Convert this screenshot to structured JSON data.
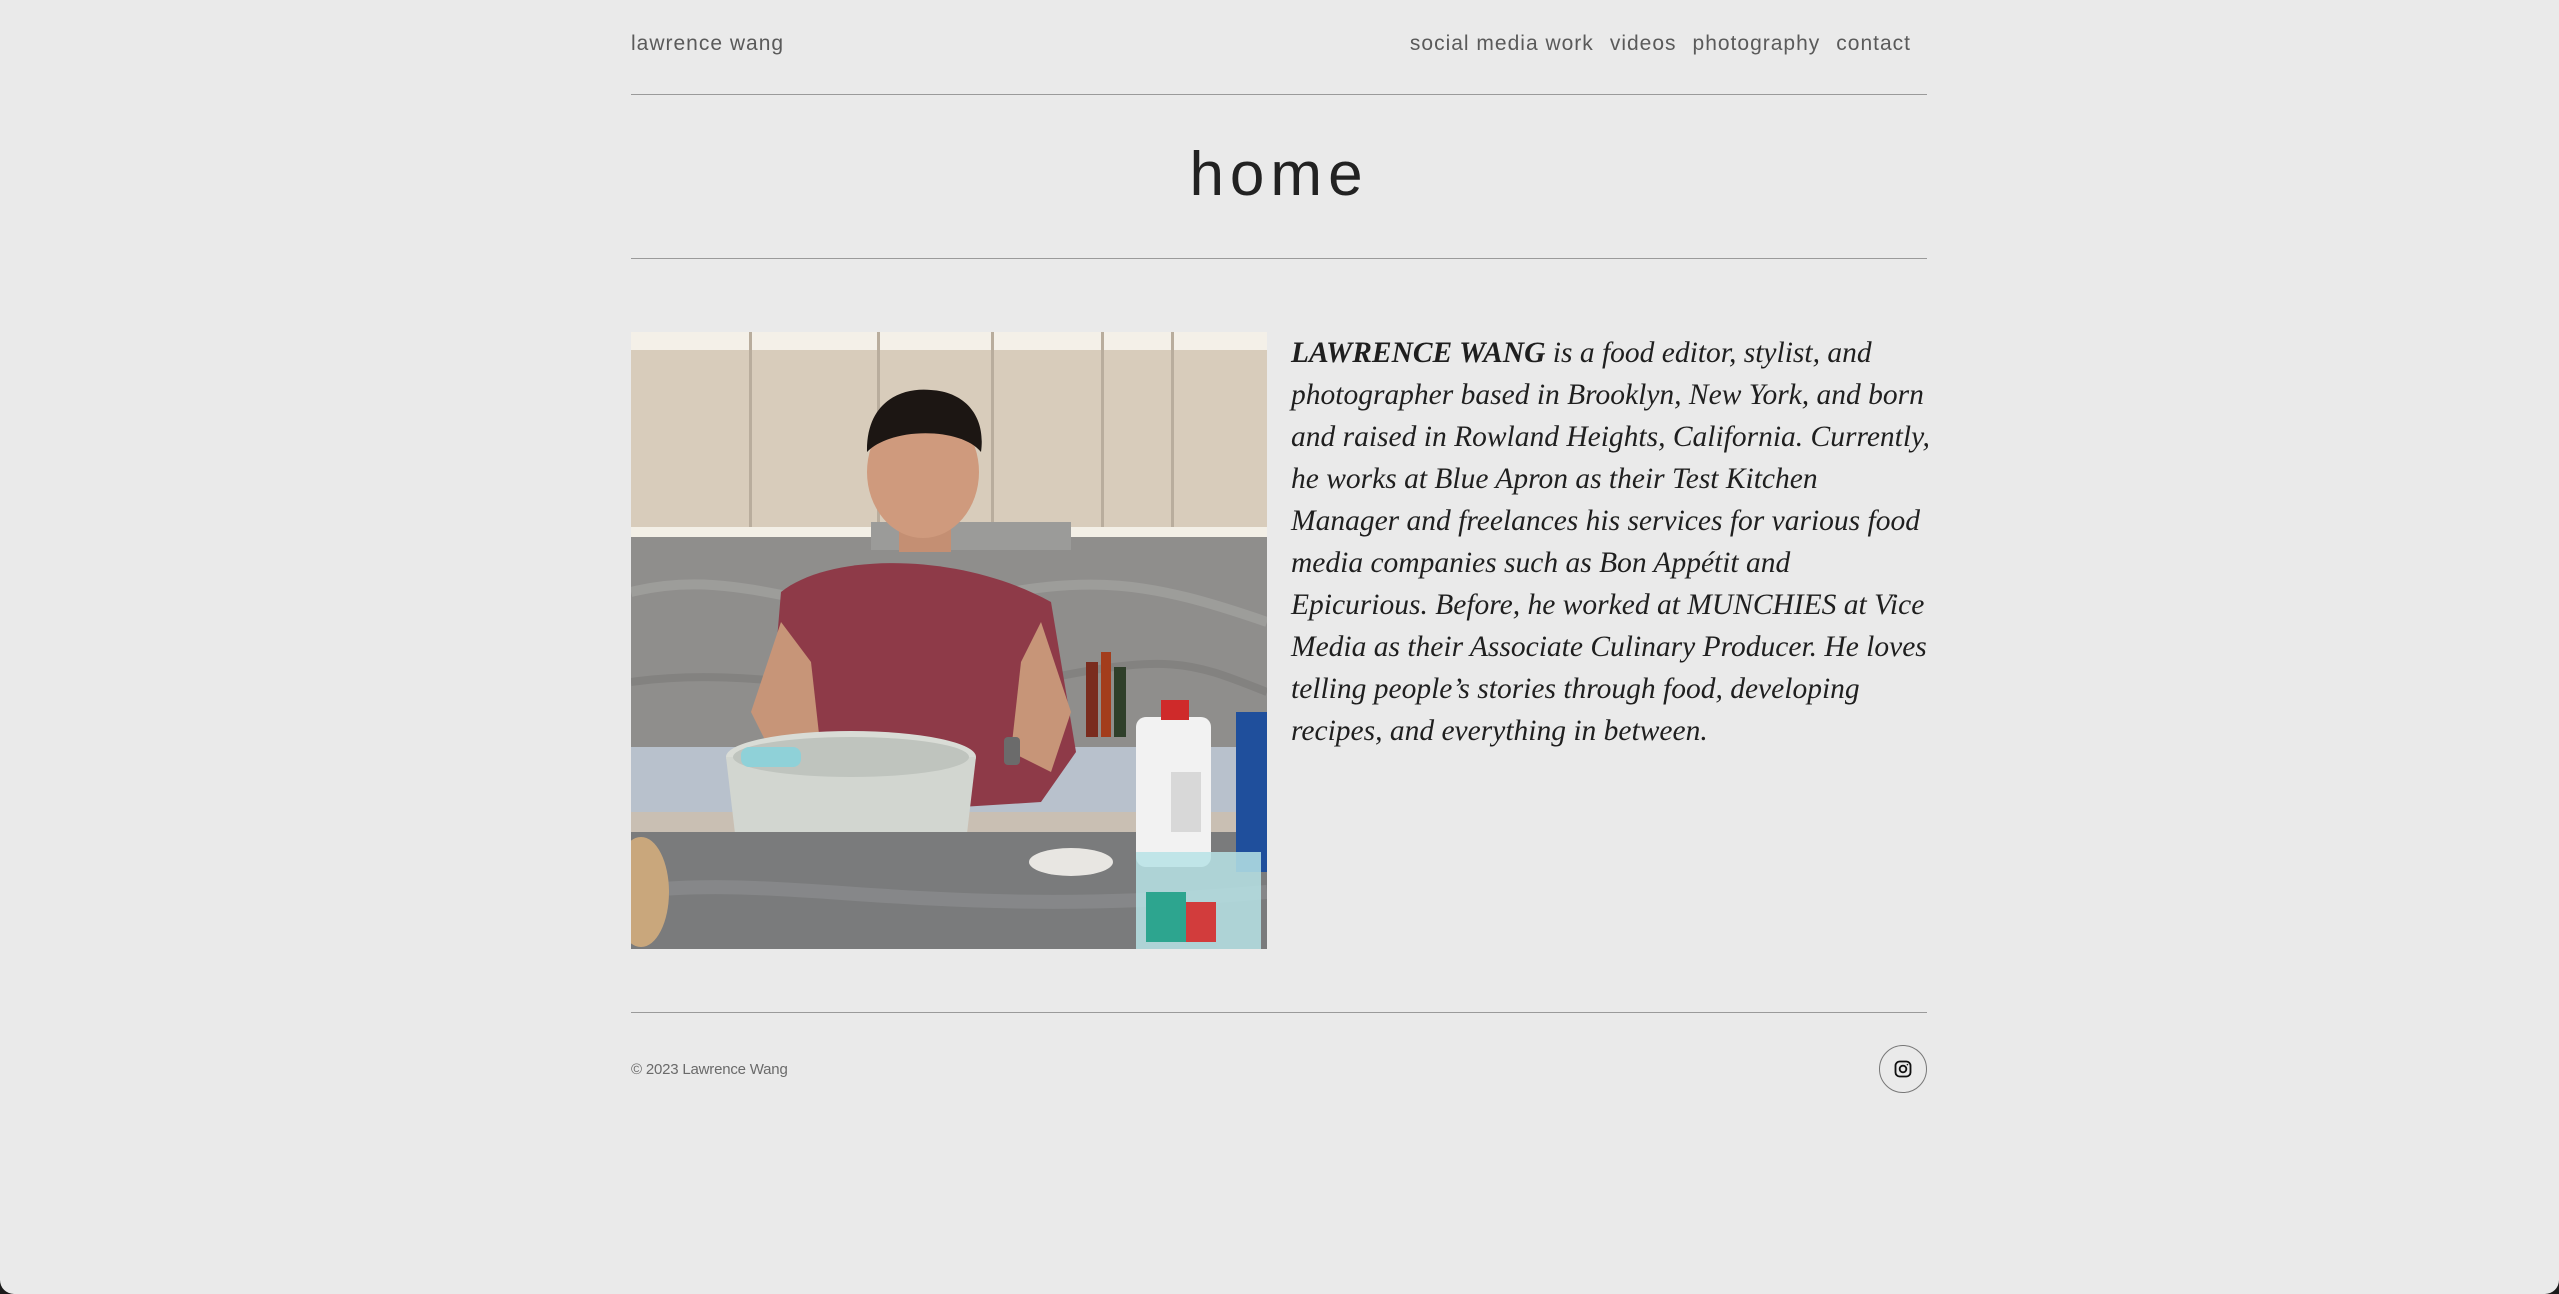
{
  "header": {
    "site_title": "lawrence wang",
    "nav": [
      {
        "label": "social media work"
      },
      {
        "label": "videos"
      },
      {
        "label": "photography"
      },
      {
        "label": "contact"
      }
    ]
  },
  "page": {
    "title": "home"
  },
  "bio": {
    "name": "LAWRENCE WANG",
    "text": " is a food editor, stylist, and photographer based in Brooklyn, New York, and born and raised in Rowland Heights, California. Currently, he works at Blue Apron as their Test Kitchen Manager and freelances his services for various food media companies such as Bon Appétit and Epicurious. Before, he worked at MUNCHIES at Vice Media as their Associate Culinary Producer. He loves telling people’s stories through food, developing recipes, and everything in between."
  },
  "footer": {
    "copyright": "© 2023 Lawrence Wang",
    "social_icon": "instagram-icon"
  },
  "colors": {
    "background": "#eaeaea",
    "text": "#222222",
    "muted_text": "#5a5a5a",
    "rule": "#9a9a9a"
  }
}
